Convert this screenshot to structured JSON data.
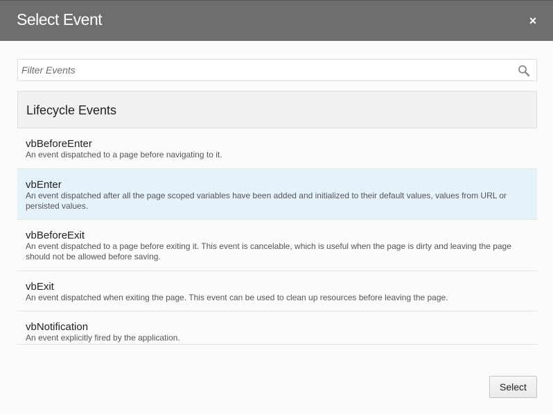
{
  "dialog": {
    "title": "Select Event",
    "close_glyph": "×",
    "close_icon": "close-icon"
  },
  "filter": {
    "placeholder": "Filter Events",
    "value": "",
    "icon": "search-icon"
  },
  "group": {
    "label": "Lifecycle Events"
  },
  "events": [
    {
      "name": "vbBeforeEnter",
      "description": "An event dispatched to a page before navigating to it.",
      "selected": false
    },
    {
      "name": "vbEnter",
      "description": "An event dispatched after all the page scoped variables have been added and initialized to their default values, values from URL or persisted values.",
      "selected": true
    },
    {
      "name": "vbBeforeExit",
      "description": "An event dispatched to a page before exiting it. This event is cancelable, which is useful when the page is dirty and leaving the page should not be allowed before saving.",
      "selected": false
    },
    {
      "name": "vbExit",
      "description": "An event dispatched when exiting the page. This event can be used to clean up resources before leaving the page.",
      "selected": false
    },
    {
      "name": "vbNotification",
      "description": "An event explicitly fired by the application.",
      "selected": false
    }
  ],
  "footer": {
    "select_label": "Select"
  },
  "colors": {
    "header_bg": "#6e6e6e",
    "selected_row_bg": "#e6f2f9",
    "group_bg": "#f1f1f1"
  }
}
